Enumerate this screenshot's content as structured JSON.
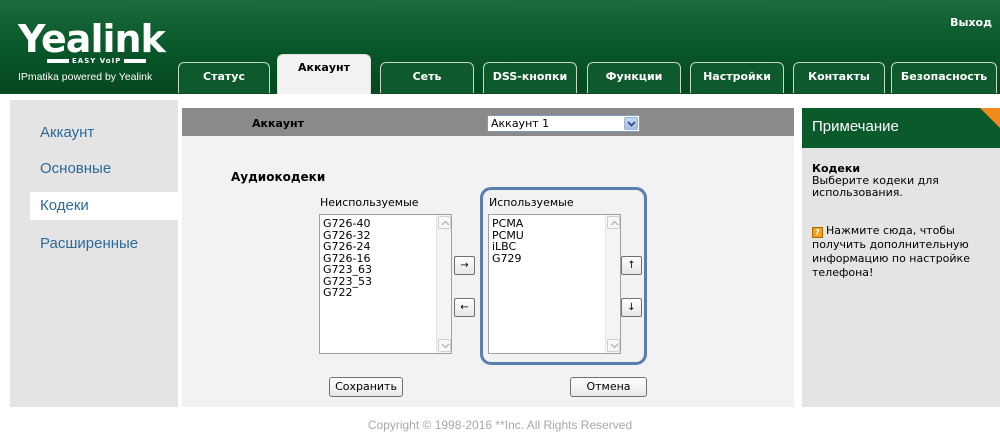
{
  "header": {
    "logo": "Yealink",
    "logo_sub": "EASY VoIP",
    "powered_by": "IPmatika powered by Yealink",
    "logout": "Выход"
  },
  "tabs": [
    {
      "label": "Статус",
      "active": false
    },
    {
      "label": "Аккаунт",
      "active": true
    },
    {
      "label": "Сеть",
      "active": false
    },
    {
      "label": "DSS-кнопки",
      "active": false
    },
    {
      "label": "Функции",
      "active": false
    },
    {
      "label": "Настройки",
      "active": false
    },
    {
      "label": "Контакты",
      "active": false
    },
    {
      "label": "Безопасность",
      "active": false
    }
  ],
  "sidebar": {
    "items": [
      {
        "label": "Аккаунт",
        "active": false
      },
      {
        "label": "Основные",
        "active": false
      },
      {
        "label": "Кодеки",
        "active": true
      },
      {
        "label": "Расширенные",
        "active": false
      }
    ]
  },
  "main": {
    "account_label": "Аккаунт",
    "account_select": "Аккаунт 1",
    "audio_title": "Аудиокодеки",
    "unused_caption": "Неиспользуемые",
    "used_caption": "Используемые",
    "unused": [
      "G726-40",
      "G726-32",
      "G726-24",
      "G726-16",
      "G723_63",
      "G723_53",
      "G722"
    ],
    "used": [
      "PCMA",
      "PCMU",
      "iLBC",
      "G729"
    ],
    "move_right": "→",
    "move_left": "←",
    "move_up": "↑",
    "move_down": "↓",
    "save_label": "Сохранить",
    "cancel_label": "Отмена"
  },
  "note": {
    "title": "Примечание",
    "heading": "Кодеки",
    "text": "Выберите кодеки для использования.",
    "help": "Нажмите сюда, чтобы получить дополнительную информацию по настройке телефона!",
    "help_icon": "?"
  },
  "footer": "Copyright © 1998-2016 **Inc. All Rights Reserved",
  "colors": {
    "header_green": "#0a5a2c",
    "link_blue": "#2b6a9c",
    "highlight_border": "#5a7dab",
    "note_corner": "#f08a1c"
  }
}
